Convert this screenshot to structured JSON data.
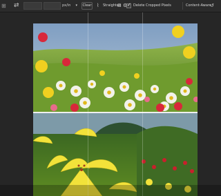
{
  "options_bar": {
    "units_value": "px/in",
    "clear_label": "Clear",
    "straighten_label": "Straighten",
    "delete_cropped_label": "Delete Cropped Pixels",
    "content_aware_label": "Content-Aware",
    "delete_cropped_checked": true
  },
  "canvas": {
    "background": "#262626"
  }
}
